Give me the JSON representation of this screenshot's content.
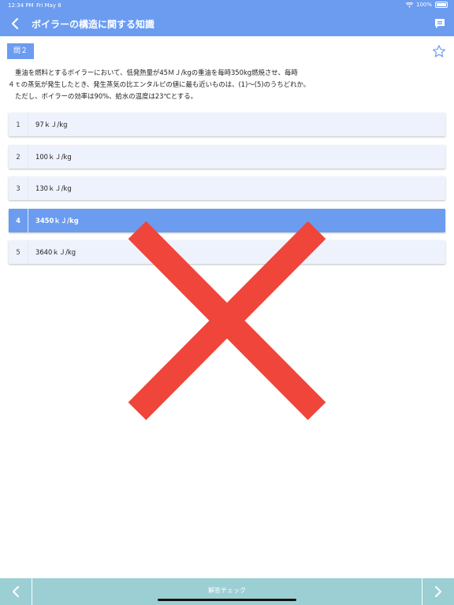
{
  "status": {
    "time": "12:34 PM",
    "date": "Fri May 8",
    "battery": "100%"
  },
  "nav": {
    "title": "ボイラーの構造に関する知識",
    "back_icon": "chevron-left-icon",
    "comment_icon": "comment-icon"
  },
  "question": {
    "number_label": "問２",
    "lines": [
      "重油を燃料とするボイラーにおいて、低発熱量が45ＭＪ/kgの重油を毎時350kg燃焼させ、毎時",
      "４ｔの蒸気が発生したとき、発生蒸気の比エンタルピの値に最も近いものは、(1)〜(5)のうちどれか。",
      "ただし、ボイラーの効率は90%、給水の温度は23℃とする。"
    ]
  },
  "choices": [
    {
      "num": "1",
      "text": "97ｋＪ/kg"
    },
    {
      "num": "2",
      "text": "100ｋＪ/kg"
    },
    {
      "num": "3",
      "text": "130ｋＪ/kg"
    },
    {
      "num": "4",
      "text": "3450ｋＪ/kg",
      "selected": true
    },
    {
      "num": "5",
      "text": "3640ｋＪ/kg"
    }
  ],
  "bottom": {
    "label": "解答チェック"
  },
  "colors": {
    "accent": "#6b9cf0",
    "choice_bg": "#eef2fc",
    "bottom_bar": "#9ccfd3",
    "wrong_mark": "#f0453a"
  }
}
